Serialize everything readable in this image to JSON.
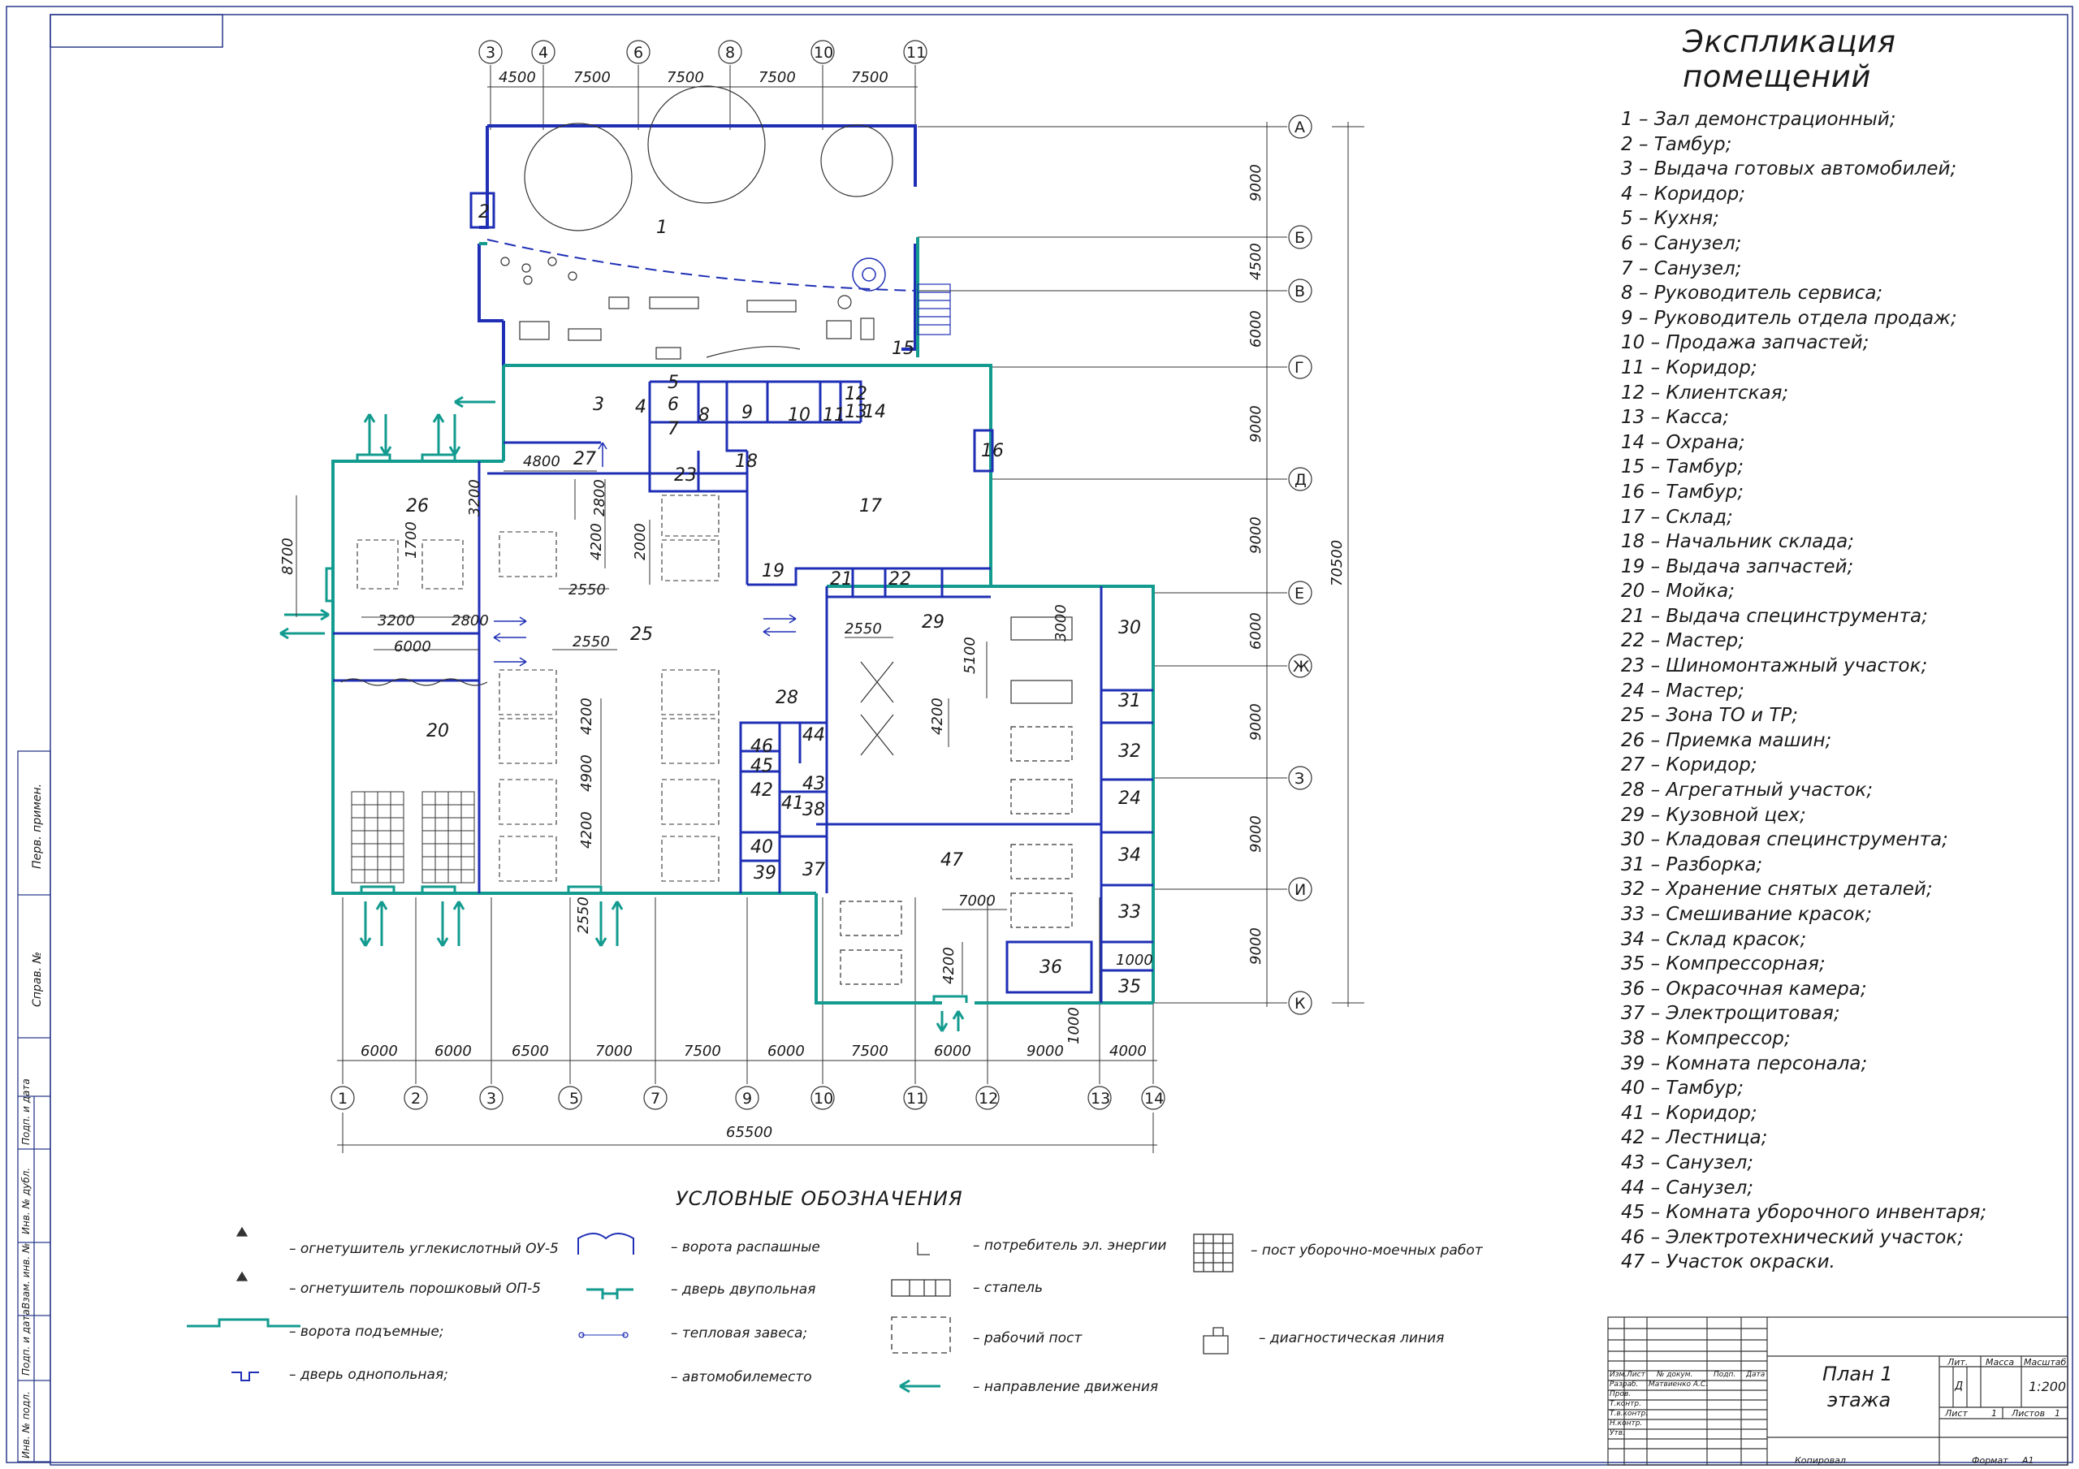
{
  "explication": {
    "title": "Экспликация помещений",
    "items": [
      "1 – Зал демонстрационный;",
      "2 – Тамбур;",
      "3 – Выдача готовых автомобилей;",
      "4 – Коридор;",
      "5 – Кухня;",
      "6 – Санузел;",
      "7 – Санузел;",
      "8 – Руководитель сервиса;",
      "9 – Руководитель отдела продаж;",
      "10 – Продажа запчастей;",
      "11 – Коридор;",
      "12 – Клиентская;",
      "13 – Касса;",
      "14 – Охрана;",
      "15 – Тамбур;",
      "16 – Тамбур;",
      "17 – Склад;",
      "18 – Начальник склада;",
      "19 – Выдача запчастей;",
      "20 – Мойка;",
      "21 – Выдача специнструмента;",
      "22 – Мастер;",
      "23 – Шиномонтажный участок;",
      "24 – Мастер;",
      "25 – Зона ТО и ТР;",
      "26 – Приемка машин;",
      "27 – Коридор;",
      "28 – Агрегатный участок;",
      "29 – Кузовной цех;",
      "30 – Кладовая специнструмента;",
      "31 – Разборка;",
      "32 – Хранение снятых деталей;",
      "33 – Смешивание красок;",
      "34 – Склад красок;",
      "35 – Компрессорная;",
      "36 – Окрасочная камера;",
      "37 – Электрощитовая;",
      "38 – Компрессор;",
      "39 – Комната персонала;",
      "40 – Тамбур;",
      "41 – Коридор;",
      "42 – Лестница;",
      "43 – Санузел;",
      "44 – Санузел;",
      "45 – Комната уборочного инвентаря;",
      "46 – Электротехнический участок;",
      "47 – Участок окраски."
    ]
  },
  "axes": {
    "top": [
      "3",
      "4",
      "6",
      "8",
      "10",
      "11"
    ],
    "top_dims": [
      "4500",
      "7500",
      "7500",
      "7500",
      "7500"
    ],
    "bottom": [
      "1",
      "2",
      "3",
      "5",
      "7",
      "9",
      "10",
      "11",
      "12",
      "13",
      "14"
    ],
    "bottom_dims": [
      "6000",
      "6000",
      "6500",
      "7000",
      "7500",
      "6000",
      "7500",
      "6000",
      "9000",
      "4000"
    ],
    "bottom_total": "65500",
    "right": [
      "А",
      "Б",
      "В",
      "Г",
      "Д",
      "Е",
      "Ж",
      "З",
      "И",
      "К"
    ],
    "right_dims": [
      "9000",
      "4500",
      "6000",
      "9000",
      "9000",
      "6000",
      "9000",
      "9000",
      "9000"
    ],
    "right_total": "70500"
  },
  "plan_dims": {
    "d4800": "4800",
    "d3200a": "3200",
    "d2800a": "2800",
    "d4200a": "4200",
    "d2000": "2000",
    "d8700": "8700",
    "d1700": "1700",
    "d3200b": "3200",
    "d2800b": "2800",
    "d6000": "6000",
    "d2550a": "2550",
    "d2550b": "2550",
    "d2550c": "2550",
    "d2550d": "2550",
    "d4200b": "4200",
    "d4900": "4900",
    "d4200c": "4200",
    "d5100": "5100",
    "d4200d": "4200",
    "d3000": "3000",
    "d7000": "7000",
    "d4200e": "4200",
    "d1000a": "1000",
    "d1000b": "1000"
  },
  "legend": {
    "title": "УСЛОВНЫЕ ОБОЗНАЧЕНИЯ",
    "items": [
      "– огнетушитель углекислотный ОУ-5",
      "– огнетушитель порошковый ОП-5",
      "– ворота подъемные;",
      "– дверь однопольная;",
      "– ворота распашные",
      "– дверь двупольная",
      "– тепловая завеса;",
      "– автомобилеместо",
      "– потребитель эл. энергии",
      "– стапель",
      "– рабочий пост",
      "– направление движения",
      "– пост уборочно-моечных работ",
      "– диагностическая линия"
    ]
  },
  "title_block": {
    "title_line1": "План 1",
    "title_line2": "этажа",
    "lit_label": "Лит.",
    "mass_label": "Масса",
    "scale_label": "Масштаб",
    "lit_value": "Д",
    "scale_value": "1:200",
    "sheet_label": "Лист",
    "sheet_value": "1",
    "sheets_label": "Листов",
    "sheets_value": "1",
    "col_headers": [
      "Изм.",
      "Лист",
      "№ докум.",
      "Подп.",
      "Дата"
    ],
    "roles": [
      "Разраб.",
      "Пров.",
      "Т.контр.",
      "Т.в.контр.",
      "Н.контр.",
      "Утв."
    ],
    "developer": "Матвиенко А.С.",
    "copied": "Копировал",
    "format_label": "Формат",
    "format_value": "А1"
  },
  "side_stamp": [
    "Перв. примен.",
    "Справ. №",
    "Подп. и дата",
    "Инв. № дубл.",
    "Взам. инв. №",
    "Подп. и дата",
    "Инв. № подл."
  ]
}
